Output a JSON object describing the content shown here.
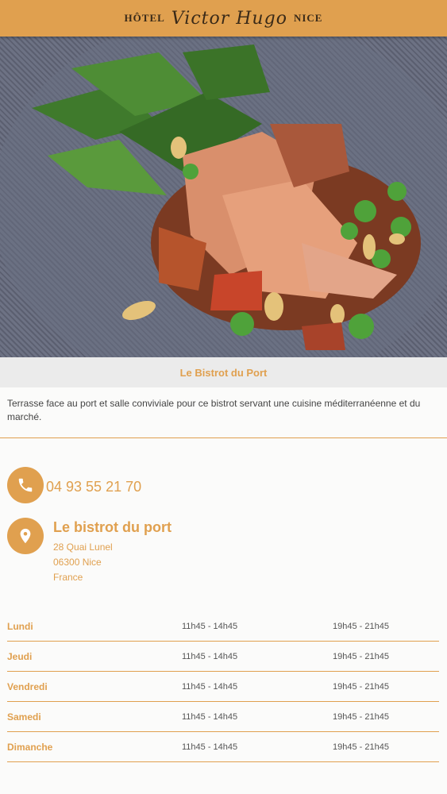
{
  "header": {
    "word_left": "HÔTEL",
    "script_name": "Victor Hugo",
    "word_right": "NICE"
  },
  "hero": {
    "caption": "Le Bistrot du Port"
  },
  "description": "Terrasse face au port et salle conviviale pour ce bistrot servant une cuisine méditerranéenne et du marché.",
  "contact": {
    "phone": "04 93 55 21 70",
    "phone_icon": "phone-icon",
    "location_icon": "map-pin-icon",
    "name": "Le bistrot du port",
    "address_lines": [
      "28 Quai Lunel",
      "06300 Nice",
      "France"
    ]
  },
  "hours": [
    {
      "day": "Lundi",
      "lunch": "11h45 - 14h45",
      "dinner": "19h45 - 21h45"
    },
    {
      "day": "Jeudi",
      "lunch": "11h45 - 14h45",
      "dinner": "19h45 - 21h45"
    },
    {
      "day": "Vendredi",
      "lunch": "11h45 - 14h45",
      "dinner": "19h45 - 21h45"
    },
    {
      "day": "Samedi",
      "lunch": "11h45 - 14h45",
      "dinner": "19h45 - 21h45"
    },
    {
      "day": "Dimanche",
      "lunch": "11h45 - 14h45",
      "dinner": "19h45 - 21h45"
    }
  ],
  "colors": {
    "accent": "#e0a04f",
    "text": "#444444"
  }
}
